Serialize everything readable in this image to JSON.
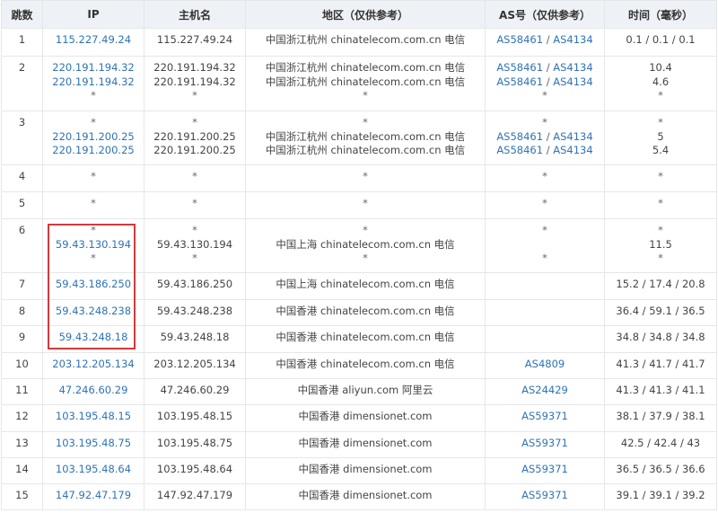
{
  "headers": [
    "跳数",
    "IP",
    "主机名",
    "地区（仅供参考）",
    "AS号（仅供参考）",
    "时间（毫秒）"
  ],
  "rows": [
    {
      "hop": "1",
      "ip": [
        "115.227.49.24"
      ],
      "host": [
        "115.227.49.24"
      ],
      "region": [
        "中国浙江杭州 chinatelecom.com.cn 电信"
      ],
      "as": [
        [
          "AS58461",
          "AS4134"
        ]
      ],
      "time": [
        "0.1 / 0.1 / 0.1"
      ],
      "height": 31
    },
    {
      "hop": "2",
      "ip": [
        "220.191.194.32",
        "220.191.194.32",
        "*"
      ],
      "host": [
        "220.191.194.32",
        "220.191.194.32",
        "*"
      ],
      "region": [
        "中国浙江杭州 chinatelecom.com.cn 电信",
        "中国浙江杭州 chinatelecom.com.cn 电信",
        "*"
      ],
      "as": [
        [
          "AS58461",
          "AS4134"
        ],
        [
          "AS58461",
          "AS4134"
        ],
        [
          "*"
        ]
      ],
      "time": [
        "10.4",
        "4.6",
        "*"
      ],
      "height": 61
    },
    {
      "hop": "3",
      "ip": [
        "*",
        "220.191.200.25",
        "220.191.200.25"
      ],
      "host": [
        "*",
        "220.191.200.25",
        "220.191.200.25"
      ],
      "region": [
        "*",
        "中国浙江杭州 chinatelecom.com.cn 电信",
        "中国浙江杭州 chinatelecom.com.cn 电信"
      ],
      "as": [
        [
          "*"
        ],
        [
          "AS58461",
          "AS4134"
        ],
        [
          "AS58461",
          "AS4134"
        ]
      ],
      "time": [
        "*",
        "5",
        "5.4"
      ],
      "height": 60
    },
    {
      "hop": "4",
      "ip": [
        "*"
      ],
      "host": [
        "*"
      ],
      "region": [
        "*"
      ],
      "as": [
        [
          "*"
        ]
      ],
      "time": [
        "*"
      ],
      "height": 30
    },
    {
      "hop": "5",
      "ip": [
        "*"
      ],
      "host": [
        "*"
      ],
      "region": [
        "*"
      ],
      "as": [
        [
          "*"
        ]
      ],
      "time": [
        "*"
      ],
      "height": 30
    },
    {
      "hop": "6",
      "ip": [
        "*",
        "59.43.130.194",
        "*"
      ],
      "host": [
        "*",
        "59.43.130.194",
        "*"
      ],
      "region": [
        "*",
        "中国上海 chinatelecom.com.cn 电信",
        "*"
      ],
      "as": [
        [
          "*"
        ],
        [
          ""
        ],
        [
          "*"
        ]
      ],
      "time": [
        "*",
        "11.5",
        "*"
      ],
      "height": 60
    },
    {
      "hop": "7",
      "ip": [
        "59.43.186.250"
      ],
      "host": [
        "59.43.186.250"
      ],
      "region": [
        "中国上海 chinatelecom.com.cn 电信"
      ],
      "as": [
        [
          ""
        ]
      ],
      "time": [
        "15.2 / 17.4 / 20.8"
      ],
      "height": 30
    },
    {
      "hop": "8",
      "ip": [
        "59.43.248.238"
      ],
      "host": [
        "59.43.248.238"
      ],
      "region": [
        "中国香港 chinatelecom.com.cn 电信"
      ],
      "as": [
        [
          ""
        ]
      ],
      "time": [
        "36.4 / 59.1 / 36.5"
      ],
      "height": 29
    },
    {
      "hop": "9",
      "ip": [
        "59.43.248.18"
      ],
      "host": [
        "59.43.248.18"
      ],
      "region": [
        "中国香港 chinatelecom.com.cn 电信"
      ],
      "as": [
        [
          ""
        ]
      ],
      "time": [
        "34.8 / 34.8 / 34.8"
      ],
      "height": 30
    },
    {
      "hop": "10",
      "ip": [
        "203.12.205.134"
      ],
      "host": [
        "203.12.205.134"
      ],
      "region": [
        "中国香港 chinatelecom.com.cn 电信"
      ],
      "as": [
        [
          "AS4809"
        ]
      ],
      "time": [
        "41.3 / 41.7 / 41.7"
      ],
      "height": 29
    },
    {
      "hop": "11",
      "ip": [
        "47.246.60.29"
      ],
      "host": [
        "47.246.60.29"
      ],
      "region": [
        "中国香港 aliyun.com 阿里云"
      ],
      "as": [
        [
          "AS24429"
        ]
      ],
      "time": [
        "41.3 / 41.3 / 41.1"
      ],
      "height": 29
    },
    {
      "hop": "12",
      "ip": [
        "103.195.48.15"
      ],
      "host": [
        "103.195.48.15"
      ],
      "region": [
        "中国香港 dimensionet.com"
      ],
      "as": [
        [
          "AS59371"
        ]
      ],
      "time": [
        "38.1 / 37.9 / 38.1"
      ],
      "height": 30
    },
    {
      "hop": "13",
      "ip": [
        "103.195.48.75"
      ],
      "host": [
        "103.195.48.75"
      ],
      "region": [
        "中国香港 dimensionet.com"
      ],
      "as": [
        [
          "AS59371"
        ]
      ],
      "time": [
        "42.5 / 42.4 / 43"
      ],
      "height": 29
    },
    {
      "hop": "14",
      "ip": [
        "103.195.48.64"
      ],
      "host": [
        "103.195.48.64"
      ],
      "region": [
        "中国香港 dimensionet.com"
      ],
      "as": [
        [
          "AS59371"
        ]
      ],
      "time": [
        "36.5 / 36.5 / 36.6"
      ],
      "height": 29
    },
    {
      "hop": "15",
      "ip": [
        "147.92.47.179"
      ],
      "host": [
        "147.92.47.179"
      ],
      "region": [
        "中国香港 dimensionet.com"
      ],
      "as": [
        [
          "AS59371"
        ]
      ],
      "time": [
        "39.1 / 39.1 / 39.2"
      ],
      "height": 29
    }
  ],
  "colors": {
    "link": "#2f73b6",
    "header_bg": "#eef1f5",
    "highlight": "#d23a3a"
  }
}
